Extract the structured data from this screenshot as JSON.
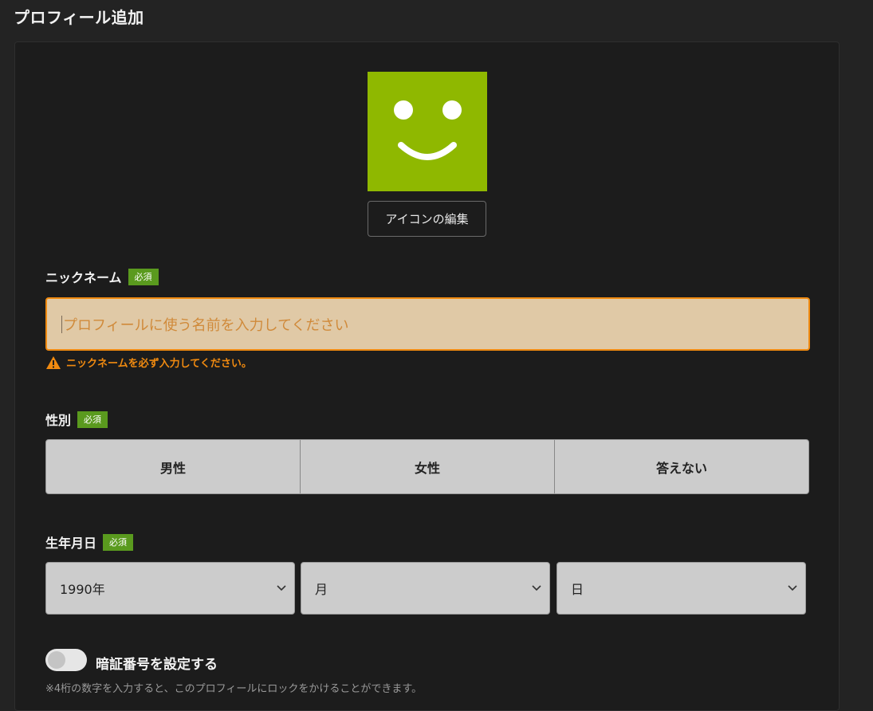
{
  "page": {
    "title": "プロフィール追加"
  },
  "avatar": {
    "icon": "smiley-face-icon",
    "bg_color": "#8fb800"
  },
  "edit_icon_button": {
    "label": "アイコンの編集"
  },
  "nickname": {
    "label": "ニックネーム",
    "required_badge": "必須",
    "placeholder": "プロフィールに使う名前を入力してください",
    "value": "",
    "error": "ニックネームを必ず入力してください。"
  },
  "gender": {
    "label": "性別",
    "required_badge": "必須",
    "options": [
      "男性",
      "女性",
      "答えない"
    ]
  },
  "birthday": {
    "label": "生年月日",
    "required_badge": "必須",
    "year": "1990年",
    "month": "月",
    "day": "日"
  },
  "pin": {
    "toggle_on": false,
    "label": "暗証番号を設定する",
    "note": "※4桁の数字を入力すると、このプロフィールにロックをかけることができます。"
  },
  "colors": {
    "accent_error": "#f08a10",
    "required_badge": "#5a9a1e"
  }
}
